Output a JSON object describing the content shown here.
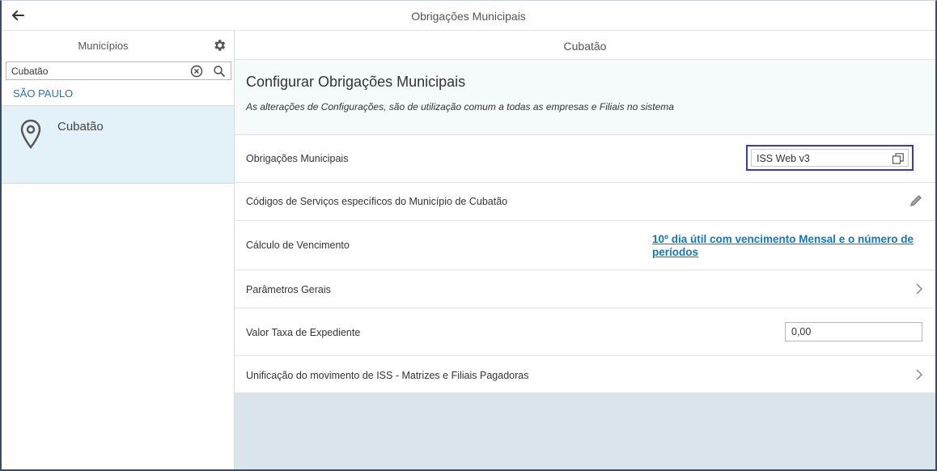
{
  "window": {
    "title": "Obrigações Municipais"
  },
  "sidebar": {
    "header": "Municípios",
    "search": {
      "value": "Cubatão",
      "placeholder": ""
    },
    "groups": [
      {
        "label": "SÃO PAULO",
        "items": [
          {
            "label": "Cubatão",
            "selected": true
          }
        ]
      }
    ]
  },
  "main": {
    "header": "Cubatão",
    "config": {
      "title": "Configurar Obrigações Municipais",
      "subtitle": "As alterações de Configurações, são de utilização comum a todas as empresas e Filiais no sistema"
    },
    "rows": {
      "obrigacoes": {
        "label": "Obrigações Municipais",
        "value": "ISS Web v3"
      },
      "codigos": {
        "label": "Códigos de Serviços específicos do Município de Cubatão"
      },
      "calculo": {
        "label": "Cálculo de Vencimento",
        "link": "10º dia útil com vencimento Mensal e o número de períodos"
      },
      "parametros": {
        "label": "Parâmetros Gerais"
      },
      "taxa": {
        "label": "Valor Taxa de Expediente",
        "value": "0,00"
      },
      "unificacao": {
        "label": "Unificação do movimento de ISS - Matrizes e Filiais Pagadoras"
      }
    }
  },
  "colors": {
    "accent": "#2a6ebb",
    "link": "#0a7bbf",
    "selected_bg": "#e3f1f8",
    "focus_border": "#3c3ab0"
  },
  "icons": [
    "arrow-left-icon",
    "gear-icon",
    "clear-icon",
    "search-icon",
    "map-pin-icon",
    "copy-icon",
    "pencil-icon",
    "chevron-right-icon"
  ]
}
